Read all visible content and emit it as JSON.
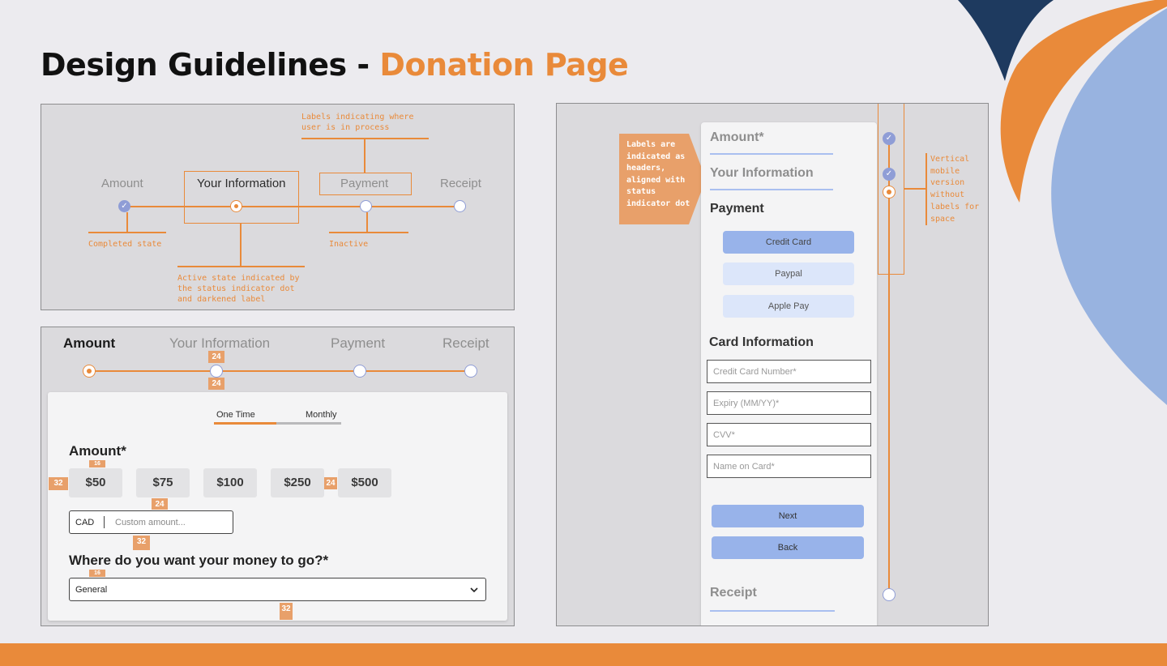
{
  "title": {
    "main": "Design Guidelines - ",
    "accent": "Donation Page"
  },
  "colors": {
    "accent": "#e98a3a",
    "blue": "#8f9dd6",
    "light_blue": "#98b3ea",
    "navy": "#1e3a5f"
  },
  "panel1": {
    "steps": [
      "Amount",
      "Your Information",
      "Payment",
      "Receipt"
    ],
    "annotations": {
      "labels": "Labels indicating where user is in process",
      "completed": "Completed state",
      "active": "Active state indicated by the status indicator dot and darkened label",
      "inactive": "Inactive"
    }
  },
  "panel2": {
    "steps": [
      "Amount",
      "Your Information",
      "Payment",
      "Receipt"
    ],
    "specs": {
      "s24": "24",
      "s16": "16",
      "s32": "32"
    },
    "tabs": [
      "One Time",
      "Monthly"
    ],
    "amount_heading": "Amount*",
    "amounts": [
      "$50",
      "$75",
      "$100",
      "$250",
      "$500"
    ],
    "currency": "CAD",
    "custom_placeholder": "Custom amount...",
    "destination_heading": "Where do you want your money to go?*",
    "destination_value": "General"
  },
  "panel3": {
    "callout": "Labels are indicated as headers, aligned with status indicator dot",
    "vertical_note": "Vertical mobile version without labels for space",
    "headers": {
      "amount": "Amount*",
      "info": "Your Information",
      "payment": "Payment",
      "card": "Card Information",
      "receipt": "Receipt"
    },
    "payment_options": [
      "Credit Card",
      "Paypal",
      "Apple Pay"
    ],
    "fields": [
      "Credit Card Number*",
      "Expiry (MM/YY)*",
      "CVV*",
      "Name on Card*"
    ],
    "buttons": {
      "next": "Next",
      "back": "Back"
    }
  },
  "icons": {
    "check": "checkmark-icon",
    "chevron": "chevron-down-icon"
  }
}
